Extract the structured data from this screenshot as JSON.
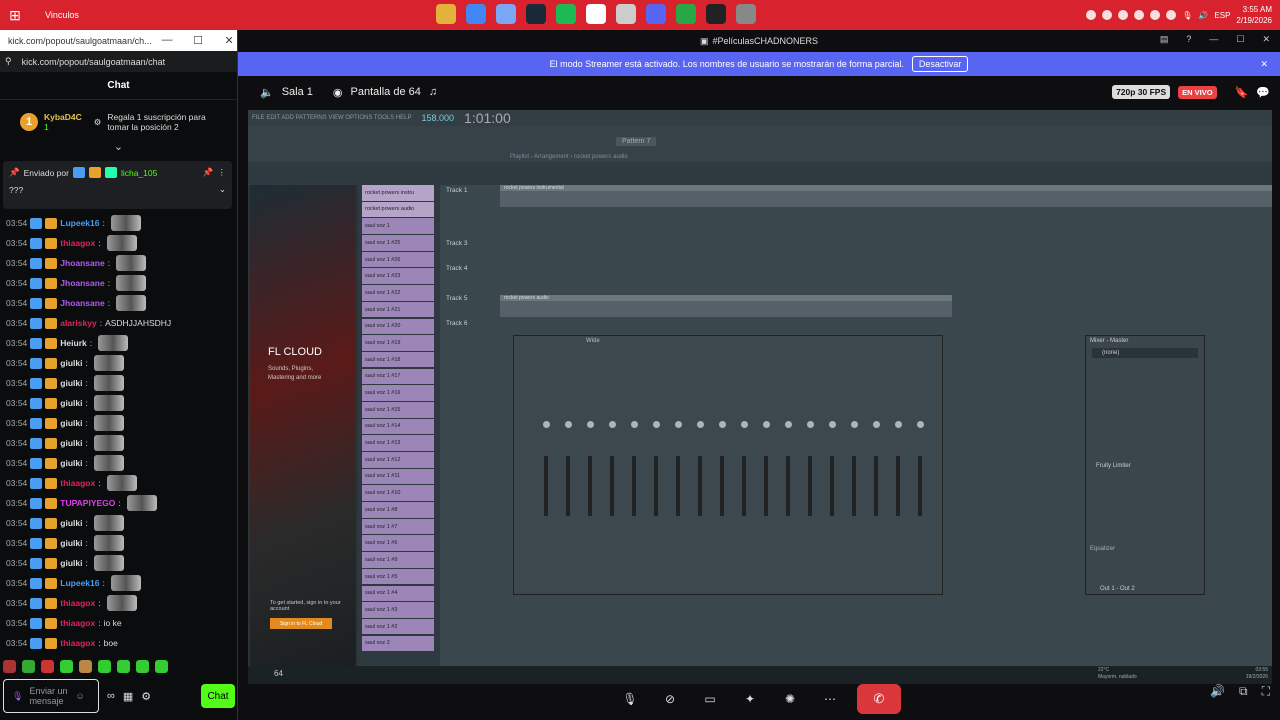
{
  "taskbar": {
    "app_label": "Vinculos",
    "lang": "ESP",
    "time": "3:55 AM",
    "date": "2/19/2026",
    "pins": [
      {
        "icon": "folder-icon",
        "color": "#e3b23c"
      },
      {
        "icon": "chrome-icon",
        "color": "#4285f4"
      },
      {
        "icon": "app-icon",
        "color": "#7aa6f5"
      },
      {
        "icon": "steam-icon",
        "color": "#1b2838"
      },
      {
        "icon": "spotify-icon",
        "color": "#1db954"
      },
      {
        "icon": "calendar-icon",
        "color": "#fff"
      },
      {
        "icon": "bag-icon",
        "color": "#ccc"
      },
      {
        "icon": "discord-icon",
        "color": "#5865f2"
      },
      {
        "icon": "game-icon",
        "color": "#28a745"
      },
      {
        "icon": "obs-icon",
        "color": "#222"
      },
      {
        "icon": "kick-icon",
        "color": "#888"
      }
    ]
  },
  "popout": {
    "url": "kick.com/popout/saulgoatmaan/ch...",
    "address": "kick.com/popout/saulgoatmaan/chat",
    "chat_title": "Chat",
    "leader": {
      "rank": "1",
      "name": "KybaD4C",
      "count": "1",
      "gift_text": "Regala 1 suscripción para tomar la posición 2"
    },
    "pinned": {
      "by": "Enviado por",
      "user": "licha_105",
      "text": "???"
    },
    "messages": [
      {
        "time": "03:54",
        "user": "Lupeek16",
        "color": "#4a9df0",
        "text": ""
      },
      {
        "time": "03:54",
        "user": "thiaagox",
        "color": "#e0245e",
        "text": ""
      },
      {
        "time": "03:54",
        "user": "Jhoansane",
        "color": "#b25cf0",
        "text": ""
      },
      {
        "time": "03:54",
        "user": "Jhoansane",
        "color": "#b25cf0",
        "text": ""
      },
      {
        "time": "03:54",
        "user": "Jhoansane",
        "color": "#b25cf0",
        "text": ""
      },
      {
        "time": "03:54",
        "user": "alariskyy",
        "color": "#e0245e",
        "text": "ASDHJJAHSDHJ"
      },
      {
        "time": "03:54",
        "user": "Heiurk",
        "color": "#dddddd",
        "text": ""
      },
      {
        "time": "03:54",
        "user": "giulki",
        "color": "#dddddd",
        "text": ""
      },
      {
        "time": "03:54",
        "user": "giulki",
        "color": "#dddddd",
        "text": ""
      },
      {
        "time": "03:54",
        "user": "giulki",
        "color": "#dddddd",
        "text": ""
      },
      {
        "time": "03:54",
        "user": "giulki",
        "color": "#dddddd",
        "text": ""
      },
      {
        "time": "03:54",
        "user": "giulki",
        "color": "#dddddd",
        "text": ""
      },
      {
        "time": "03:54",
        "user": "giulki",
        "color": "#dddddd",
        "text": ""
      },
      {
        "time": "03:54",
        "user": "thiaagox",
        "color": "#e0245e",
        "text": ""
      },
      {
        "time": "03:54",
        "user": "TUPAPIYEGO",
        "color": "#e03cf0",
        "text": ""
      },
      {
        "time": "03:54",
        "user": "giulki",
        "color": "#dddddd",
        "text": ""
      },
      {
        "time": "03:54",
        "user": "giulki",
        "color": "#dddddd",
        "text": ""
      },
      {
        "time": "03:54",
        "user": "giulki",
        "color": "#dddddd",
        "text": ""
      },
      {
        "time": "03:54",
        "user": "Lupeek16",
        "color": "#4a9df0",
        "text": ""
      },
      {
        "time": "03:54",
        "user": "thiaagox",
        "color": "#e0245e",
        "text": ""
      },
      {
        "time": "03:54",
        "user": "thiaagox",
        "color": "#e0245e",
        "text": "io ke"
      },
      {
        "time": "03:54",
        "user": "thiaagox",
        "color": "#e0245e",
        "text": "boe"
      }
    ],
    "compose_placeholder": "Enviar un mensaje",
    "chat_button": "Chat"
  },
  "discord": {
    "title": "#PelículasCHADNONERS",
    "streamer_notice": "El modo Streamer está activado. Los nombres de usuario se mostrarán de forma parcial.",
    "deactivate": "Desactivar",
    "room": "Sala 1",
    "screen": "Pantalla de 64",
    "quality": "720p 30 FPS",
    "live": "EN VIVO"
  },
  "fl": {
    "menu": "FILE EDIT ADD PATTERNS VIEW OPTIONS TOOLS HELP",
    "time": "1:01:00",
    "tempo": "158.000",
    "pattern": "Pattern 7",
    "playlist_title": "Playlist - Arrangement › rocket powers audio",
    "cloud_title": "FL CLOUD",
    "cloud_sub": "Sounds, Plugins, Mastering and more",
    "signin_text": "To get started, sign in to your account",
    "signin_btn": "Sign in to FL Cloud",
    "channels": [
      "rocket powers instru",
      "rocket powers audio",
      "saul voz 1",
      "saul voz 1 #25",
      "saul voz 1 #26",
      "saul voz 1 #23",
      "saul voz 1 #22",
      "saul voz 1 #21",
      "saul voz 1 #20",
      "saul voz 1 #19",
      "saul voz 1 #18",
      "saul voz 1 #17",
      "saul voz 1 #16",
      "saul voz 1 #15",
      "saul voz 1 #14",
      "saul voz 1 #13",
      "saul voz 1 #12",
      "saul voz 1 #11",
      "saul voz 1 #10",
      "saul voz 1 #8",
      "saul voz 1 #7",
      "saul voz 1 #6",
      "saul voz 1 #9",
      "saul voz 1 #5",
      "saul voz 1 #4",
      "saul voz 1 #3",
      "saul voz 1 #2",
      "saul voz 2"
    ],
    "tracks": [
      "Track 1",
      "Track 3",
      "Track 4",
      "Track 5",
      "Track 6"
    ],
    "clips": [
      "rocket powers instrumental",
      "rocket powers audio"
    ],
    "mixer_title": "Mixer - Master",
    "mixer_none": "(none)",
    "limiter": "Fruity Limiter",
    "equalizer": "Equalizer",
    "output": "Out 1 - Out 2",
    "wide": "Wide"
  },
  "win_taskbar": {
    "count": "64",
    "weather_temp": "22°C",
    "weather_text": "Mayorm. nublado",
    "time": "03:55",
    "date": "19/2/2026"
  }
}
